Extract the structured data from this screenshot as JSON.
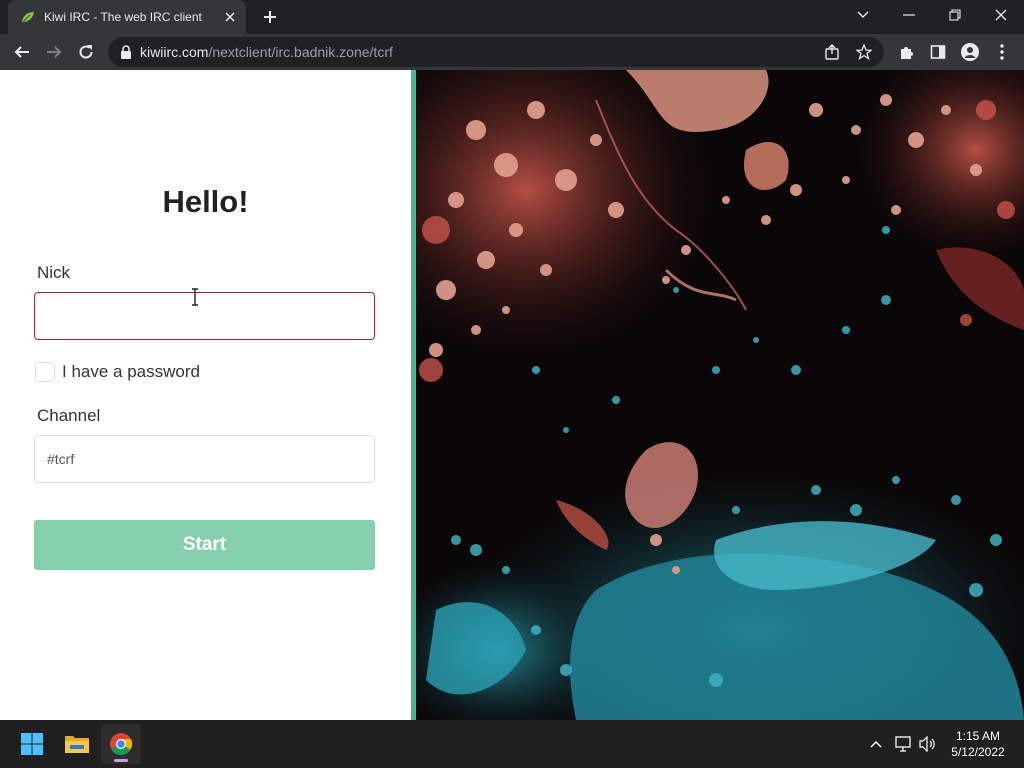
{
  "browser": {
    "tab_title": "Kiwi IRC - The web IRC client",
    "url_host": "kiwiirc.com",
    "url_path": "/nextclient/irc.badnik.zone/tcrf"
  },
  "form": {
    "heading": "Hello!",
    "nick_label": "Nick",
    "nick_value": "",
    "password_label": "I have a password",
    "password_checked": false,
    "channel_label": "Channel",
    "channel_value": "#tcrf",
    "start_label": "Start"
  },
  "colors": {
    "accent": "#42b992",
    "start_button": "#86cfac",
    "nick_error_border": "#a5263a"
  },
  "taskbar": {
    "apps": [
      "windows-start-icon",
      "file-explorer-icon",
      "chrome-icon"
    ],
    "time": "1:15 AM",
    "date": "5/12/2022"
  }
}
